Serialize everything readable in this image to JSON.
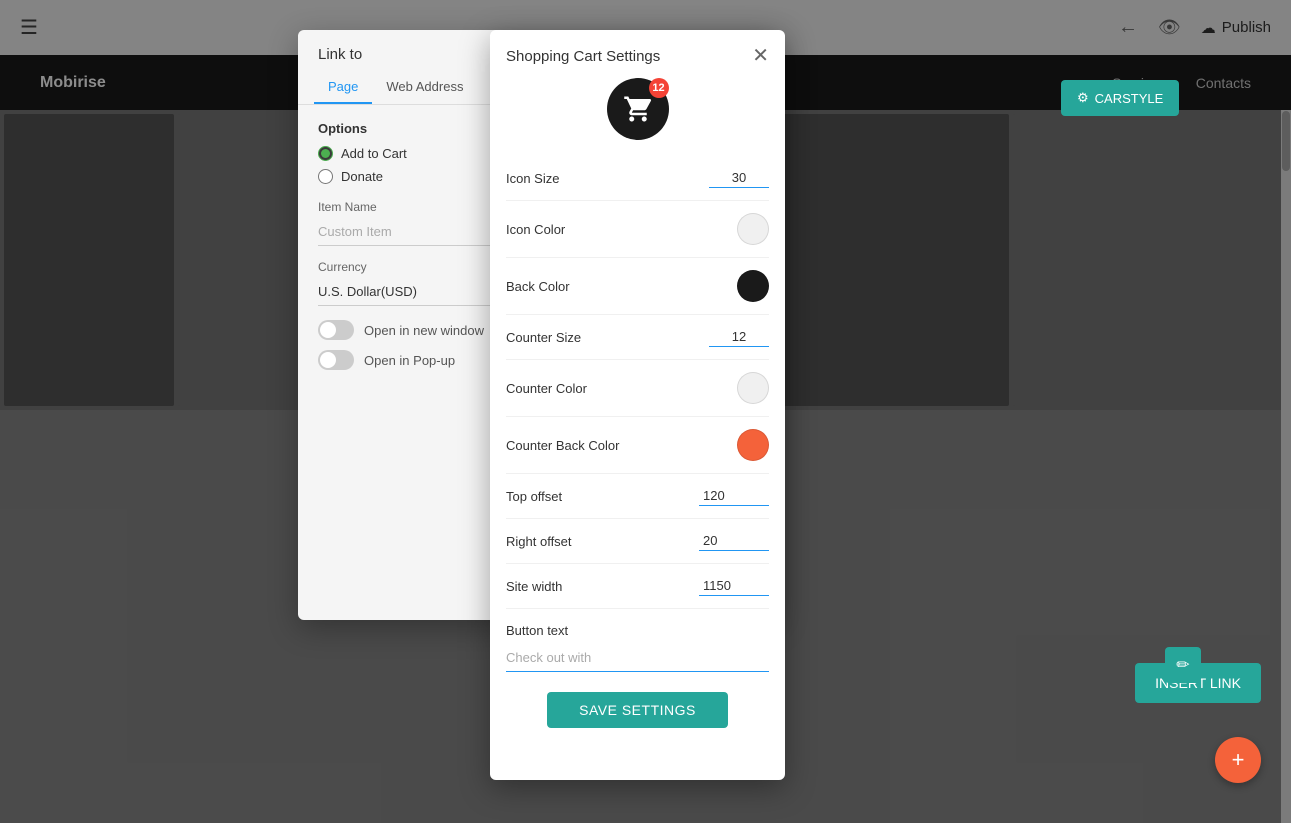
{
  "topbar": {
    "publish_label": "Publish"
  },
  "website_nav": {
    "logo": "Mobirise",
    "links": [
      "Services",
      "Contacts"
    ]
  },
  "link_to_dialog": {
    "title": "Link to",
    "tabs": [
      "Page",
      "Web Address"
    ],
    "active_tab": "Page",
    "options_label": "Options",
    "option_add_to_cart": "Add to Cart",
    "option_donate": "Donate",
    "item_name_label": "Item Name",
    "item_name_placeholder": "Custom Item",
    "currency_label": "Currency",
    "currency_value": "U.S. Dollar(USD)",
    "open_new_window_label": "Open in new window",
    "open_popup_label": "Open in Pop-up",
    "insert_link_label": "INSERT LINK"
  },
  "cart_dialog": {
    "title": "Shopping Cart Settings",
    "badge_count": "12",
    "icon_size_label": "Icon Size",
    "icon_size_value": "30",
    "icon_color_label": "Icon Color",
    "back_color_label": "Back Color",
    "counter_size_label": "Counter Size",
    "counter_size_value": "12",
    "counter_color_label": "Counter Color",
    "counter_back_color_label": "Counter Back Color",
    "top_offset_label": "Top offset",
    "top_offset_value": "120",
    "right_offset_label": "Right offset",
    "right_offset_value": "20",
    "site_width_label": "Site width",
    "site_width_value": "1150",
    "button_text_label": "Button text",
    "button_text_placeholder": "Check out with",
    "save_settings_label": "SAVE SETTINGS"
  },
  "right_panel": {
    "carstyle_label": "CARSTYLE",
    "insert_link_label": "INSERT LINK"
  },
  "colors": {
    "teal": "#26a69a",
    "orange": "#f4623a",
    "icon_bg": "#1a1a1a"
  }
}
